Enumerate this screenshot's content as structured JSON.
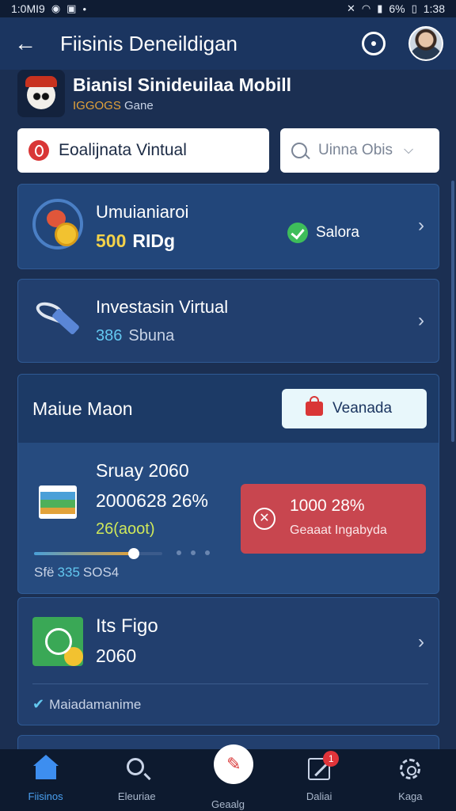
{
  "status_bar": {
    "time_left": "1:0MI9",
    "battery": "6%",
    "time_right": "1:38"
  },
  "app_bar": {
    "title": "Fiisinis Deneildigan",
    "back_icon": "arrow-left-icon",
    "settings_icon": "gear-icon"
  },
  "game": {
    "title": "Bianisl Sinideuilaa Mobill",
    "sub_accent": "IGGOGS",
    "sub_rest": " Gane"
  },
  "filters": {
    "left_label": "Eoalijnata Vintual",
    "right_placeholder": "Uinna Obis"
  },
  "card_balance": {
    "title": "Umuianiaroi",
    "amount": "500",
    "unit": "RIDg",
    "status": "Salora"
  },
  "card_invest": {
    "title": "Investasin Virtual",
    "number": "386",
    "suffix": "Sbuna"
  },
  "main_card": {
    "title": "Maiue Maon",
    "button_label": "Veanada",
    "line1": "Sruay 2060",
    "line2": "2000628 26%",
    "line3": "26(aoot)",
    "progress": 0.78,
    "foot_prefix": "Sfë",
    "foot_number": "335",
    "foot_suffix": "SOS4",
    "alert_title": "1000 28%",
    "alert_sub": "Geaaat Ingabyda"
  },
  "card_figo": {
    "title": "Its Figo",
    "value": "2060",
    "foot": "Maiadamanime"
  },
  "nav": [
    {
      "label": "Fiisinos",
      "icon": "home-icon",
      "active": true
    },
    {
      "label": "Eleuriae",
      "icon": "search-icon",
      "active": false
    },
    {
      "label": "Geaalg",
      "icon": "pen-icon",
      "active": false
    },
    {
      "label": "Daliai",
      "icon": "edit-icon",
      "active": false,
      "badge": "1"
    },
    {
      "label": "Kaga",
      "icon": "settings-icon",
      "active": false
    }
  ],
  "colors": {
    "accent": "#3d8ef0",
    "card": "#22467a",
    "alert": "#c8464f",
    "success": "#3ebd5a"
  }
}
